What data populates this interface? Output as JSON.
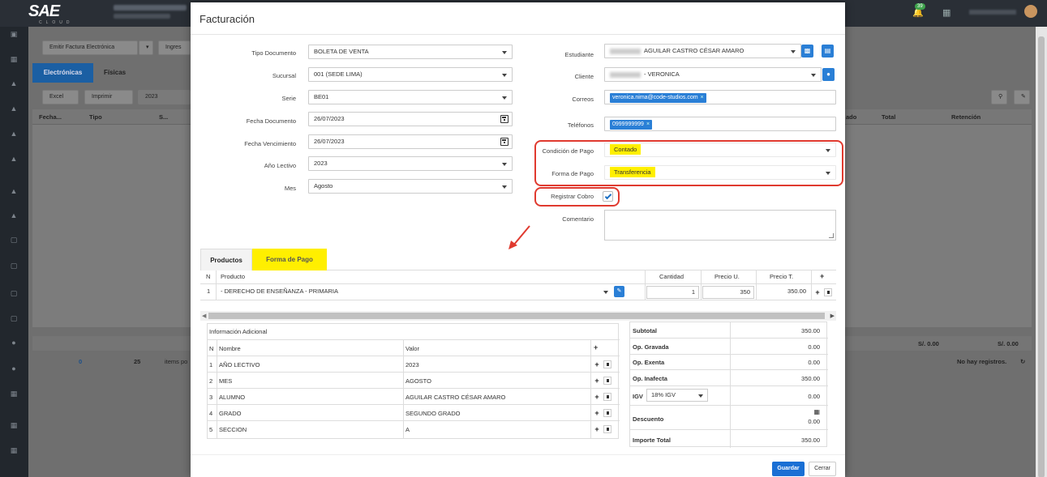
{
  "app": {
    "logo": "SAE",
    "logo_sub": "CLOUD",
    "notifications": "39"
  },
  "background": {
    "toolbar": {
      "emit_electronic": "Emitir Factura Electrónica",
      "ingresar": "Ingres",
      "excel": "Excel",
      "print": "Imprimir",
      "year": "2023"
    },
    "tabs": [
      "Electrónicas",
      "Físicas"
    ],
    "columns": [
      "Fecha...",
      "Tipo",
      "S...",
      "ado",
      "Total",
      "Retención"
    ],
    "footer": {
      "total1": "S/. 0.00",
      "total2": "S/. 0.00"
    },
    "pager": {
      "page": "0",
      "page_size": "25",
      "items_label": "items po",
      "no_records": "No hay registros."
    }
  },
  "modal": {
    "title": "Facturación",
    "left_form": {
      "tipo_documento": {
        "label": "Tipo Documento",
        "value": "BOLETA DE VENTA"
      },
      "sucursal": {
        "label": "Sucursal",
        "value": "001 (SEDE LIMA)"
      },
      "serie": {
        "label": "Serie",
        "value": "BE01"
      },
      "fecha_documento": {
        "label": "Fecha Documento",
        "value": "26/07/2023"
      },
      "fecha_vencimiento": {
        "label": "Fecha Vencimiento",
        "value": "26/07/2023"
      },
      "anio_lectivo": {
        "label": "Año Lectivo",
        "value": "2023"
      },
      "mes": {
        "label": "Mes",
        "value": "Agosto"
      }
    },
    "right_form": {
      "estudiante": {
        "label": "Estudiante",
        "value": "AGUILAR CASTRO CÉSAR AMARO"
      },
      "cliente": {
        "label": "Cliente",
        "value": "- VERONICA"
      },
      "correos": {
        "label": "Correos",
        "chip": "veronica.nima@code-studios.com"
      },
      "telefonos": {
        "label": "Teléfonos",
        "chip": "0999999999"
      },
      "condicion_pago": {
        "label": "Condición de Pago",
        "value": "Contado"
      },
      "forma_pago": {
        "label": "Forma de Pago",
        "value": "Transferencia"
      },
      "registrar_cobro": {
        "label": "Registrar Cobro",
        "checked": true
      },
      "comentario": {
        "label": "Comentario",
        "value": ""
      }
    },
    "product_tabs": [
      "Productos",
      "Forma de Pago"
    ],
    "product_table": {
      "headers": {
        "n": "N",
        "producto": "Producto",
        "cantidad": "Cantidad",
        "precio_u": "Precio U.",
        "precio_t": "Precio T.",
        "add": "+"
      },
      "rows": [
        {
          "n": "1",
          "producto": "- DERECHO DE ENSEÑANZA - PRIMARIA",
          "cantidad": "1",
          "precio_u": "350",
          "precio_t": "350.00"
        }
      ]
    },
    "info_adicional": {
      "title": "Información Adicional",
      "headers": {
        "n": "N",
        "nombre": "Nombre",
        "valor": "Valor",
        "add": "+"
      },
      "rows": [
        {
          "n": "1",
          "nombre": "AÑO LECTIVO",
          "valor": "2023"
        },
        {
          "n": "2",
          "nombre": "MES",
          "valor": "AGOSTO"
        },
        {
          "n": "3",
          "nombre": "ALUMNO",
          "valor": "AGUILAR CASTRO CÉSAR AMARO"
        },
        {
          "n": "4",
          "nombre": "GRADO",
          "valor": "SEGUNDO GRADO"
        },
        {
          "n": "5",
          "nombre": "SECCION",
          "valor": "A"
        }
      ]
    },
    "totals": {
      "subtotal": {
        "label": "Subtotal",
        "value": "350.00"
      },
      "op_gravada": {
        "label": "Op. Gravada",
        "value": "0.00"
      },
      "op_exenta": {
        "label": "Op. Exenta",
        "value": "0.00"
      },
      "op_inafecta": {
        "label": "Op. Inafecta",
        "value": "350.00"
      },
      "igv": {
        "label": "IGV",
        "select": "18% IGV",
        "value": "0.00"
      },
      "descuento": {
        "label": "Descuento",
        "value": "0.00"
      },
      "importe_total": {
        "label": "Importe Total",
        "value": "350.00"
      }
    },
    "buttons": {
      "save": "Guardar",
      "close": "Cerrar"
    }
  },
  "colors": {
    "accent": "#1a6fd4",
    "highlight": "#ffef00",
    "annotation": "#e03a2f"
  }
}
